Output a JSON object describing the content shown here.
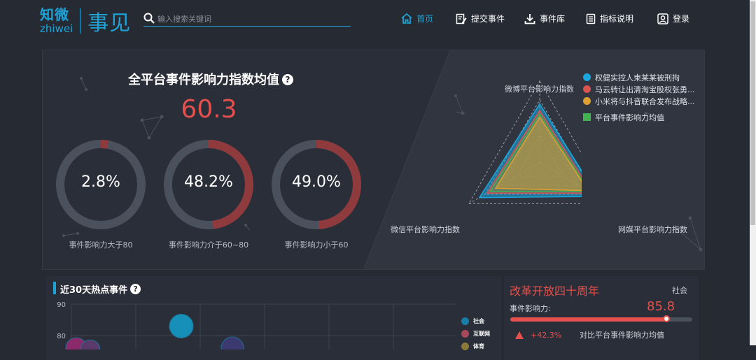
{
  "logo": {
    "cn": "知微",
    "en": "zhiwei",
    "right": "事见"
  },
  "search": {
    "placeholder": "输入搜索关键词"
  },
  "nav": {
    "home": "首页",
    "submit": "提交事件",
    "library": "事件库",
    "metrics": "指标说明",
    "login": "登录"
  },
  "summary": {
    "title": "全平台事件影响力指数均值",
    "help": "?",
    "value": "60.3",
    "donuts": [
      {
        "value": "2.8%",
        "fraction": 0.028,
        "label": "事件影响力大于80"
      },
      {
        "value": "48.2%",
        "fraction": 0.482,
        "label": "事件影响力介于60~80"
      },
      {
        "value": "49.0%",
        "fraction": 0.49,
        "label": "事件影响力小于60"
      }
    ]
  },
  "radar": {
    "axes": [
      "微博平台影响力指数",
      "网媒平台影响力指数",
      "微信平台影响力指数"
    ],
    "legend": [
      {
        "label": "权健实控人束某某被刑拘",
        "color": "#1aa7e0",
        "shape": "circle"
      },
      {
        "label": "马云转让出清淘宝股权张勇...",
        "color": "#d9534f",
        "shape": "circle"
      },
      {
        "label": "小米将与抖音联合发布战略...",
        "color": "#e0a030",
        "shape": "circle"
      },
      {
        "label": "平台事件影响力均值",
        "color": "#3fb34f",
        "shape": "square"
      }
    ],
    "series": [
      {
        "name": "权健实控人束某某被刑拘",
        "color": "#1aa7e0",
        "values": [
          0.72,
          0.82,
          0.85
        ]
      },
      {
        "name": "马云转让出清淘宝股权张勇...",
        "color": "#d9534f",
        "values": [
          0.64,
          0.74,
          0.74
        ]
      },
      {
        "name": "小米将与抖音联合发布战略...",
        "color": "#e0a030",
        "values": [
          0.56,
          0.68,
          0.62
        ]
      },
      {
        "name": "平台事件影响力均值",
        "color": "#3fb34f",
        "values": [
          0.6,
          0.7,
          0.7
        ]
      }
    ]
  },
  "hot": {
    "title": "近30天热点事件",
    "help": "?",
    "y_ticks": [
      "90",
      "80"
    ],
    "legend": [
      {
        "label": "社会",
        "color": "#167ea8"
      },
      {
        "label": "互联网",
        "color": "#a8485a"
      },
      {
        "label": "体育",
        "color": "#8a7a3a"
      }
    ],
    "chart_data": {
      "type": "scatter",
      "ylim": [
        null,
        90
      ],
      "bubbles": [
        {
          "category": "社会",
          "y": 83,
          "color": "#1690b8"
        },
        {
          "category": "互联网",
          "y": 76,
          "color": "#8a2a6a"
        },
        {
          "category": "互联网",
          "y": 75.5,
          "color": "#5a3a6a"
        },
        {
          "category": "社会",
          "y": 76,
          "color": "#3a3a70"
        }
      ]
    }
  },
  "featured": {
    "title": "改革开放四十周年",
    "category": "社会",
    "label": "事件影响力:",
    "value": "85.8",
    "fraction": 0.858,
    "stats": [
      {
        "pct": "+42.3%",
        "desc": "对比平台事件影响力均值"
      }
    ]
  },
  "colors": {
    "accent": "#1fa3d6",
    "highlight": "#e5504c"
  }
}
